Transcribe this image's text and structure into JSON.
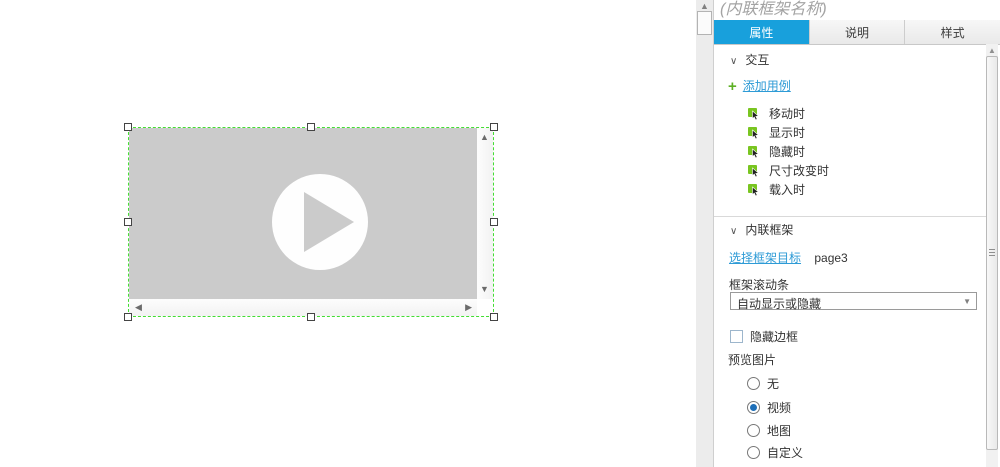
{
  "panel": {
    "title_placeholder": "(内联框架名称)",
    "tabs": [
      {
        "label": "属性",
        "active": true
      },
      {
        "label": "说明",
        "active": false
      },
      {
        "label": "样式",
        "active": false
      }
    ],
    "sections": {
      "interaction": {
        "title": "交互",
        "add_case_label": "添加用例",
        "events": [
          "移动时",
          "显示时",
          "隐藏时",
          "尺寸改变时",
          "载入时"
        ]
      },
      "inline_frame": {
        "title": "内联框架",
        "select_target_label": "选择框架目标",
        "target_value": "page3",
        "scrollbar_label": "框架滚动条",
        "scrollbar_value": "自动显示或隐藏",
        "hide_border_label": "隐藏边框",
        "hide_border_checked": false,
        "preview_label": "预览图片",
        "preview_options": [
          {
            "label": "无",
            "selected": false
          },
          {
            "label": "视频",
            "selected": true
          },
          {
            "label": "地图",
            "selected": false
          },
          {
            "label": "自定义",
            "selected": false
          }
        ]
      }
    }
  },
  "canvas": {
    "widget": "inline-frame-video-preview"
  },
  "icons": {
    "chevron_down": "∨",
    "plus": "+",
    "arrow_up": "▲",
    "arrow_down": "▼",
    "arrow_left": "◀",
    "arrow_right": "▶"
  },
  "colors": {
    "accent_blue": "#18a0dc",
    "link_blue": "#2e9bd6",
    "plus_green": "#5db024",
    "event_icon_green": "#79c520",
    "selection_green": "#44dd33",
    "widget_gray": "#cbcbcb",
    "radio_selected_blue": "#1d6fb8"
  }
}
